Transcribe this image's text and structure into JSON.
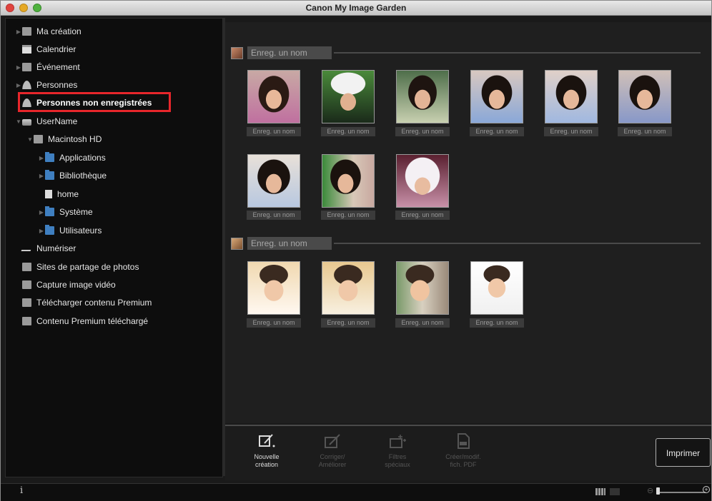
{
  "window": {
    "title": "Canon My Image Garden"
  },
  "sidebar": {
    "items": [
      {
        "label": "Ma création"
      },
      {
        "label": "Calendrier"
      },
      {
        "label": "Événement"
      },
      {
        "label": "Personnes"
      },
      {
        "label": "Personnes non enregistrées",
        "selected": true
      },
      {
        "label": "UserName"
      },
      {
        "label": "Macintosh HD"
      },
      {
        "label": "Applications"
      },
      {
        "label": "Bibliothèque"
      },
      {
        "label": "home"
      },
      {
        "label": "Système"
      },
      {
        "label": "Utilisateurs"
      },
      {
        "label": "Numériser"
      },
      {
        "label": "Sites de partage de photos"
      },
      {
        "label": "Capture image vidéo"
      },
      {
        "label": "Télécharger contenu Premium"
      },
      {
        "label": "Contenu Premium téléchargé"
      }
    ]
  },
  "groups": [
    {
      "name_placeholder": "Enreg. un nom",
      "photos": [
        {
          "label": "Enreg. un nom"
        },
        {
          "label": "Enreg. un nom"
        },
        {
          "label": "Enreg. un nom"
        },
        {
          "label": "Enreg. un nom"
        },
        {
          "label": "Enreg. un nom"
        },
        {
          "label": "Enreg. un nom"
        },
        {
          "label": "Enreg. un nom"
        },
        {
          "label": "Enreg. un nom"
        },
        {
          "label": "Enreg. un nom"
        }
      ]
    },
    {
      "name_placeholder": "Enreg. un nom",
      "photos": [
        {
          "label": "Enreg. un nom"
        },
        {
          "label": "Enreg. un nom"
        },
        {
          "label": "Enreg. un nom"
        },
        {
          "label": "Enreg. un nom"
        }
      ]
    }
  ],
  "toolbar": {
    "new_creation": {
      "line1": "Nouvelle",
      "line2": "création"
    },
    "correct": {
      "line1": "Corriger/",
      "line2": "Améliorer"
    },
    "filters": {
      "line1": "Filtres",
      "line2": "spéciaux"
    },
    "pdf": {
      "line1": "Créer/modif.",
      "line2": "fich. PDF"
    },
    "print_label": "Imprimer"
  },
  "status": {
    "info_glyph": "i",
    "zoom_min_glyph": "⊖",
    "zoom_plus_glyph": "+"
  },
  "colors": {
    "selection_highlight": "#e8262b",
    "background": "#1a1a1a"
  }
}
